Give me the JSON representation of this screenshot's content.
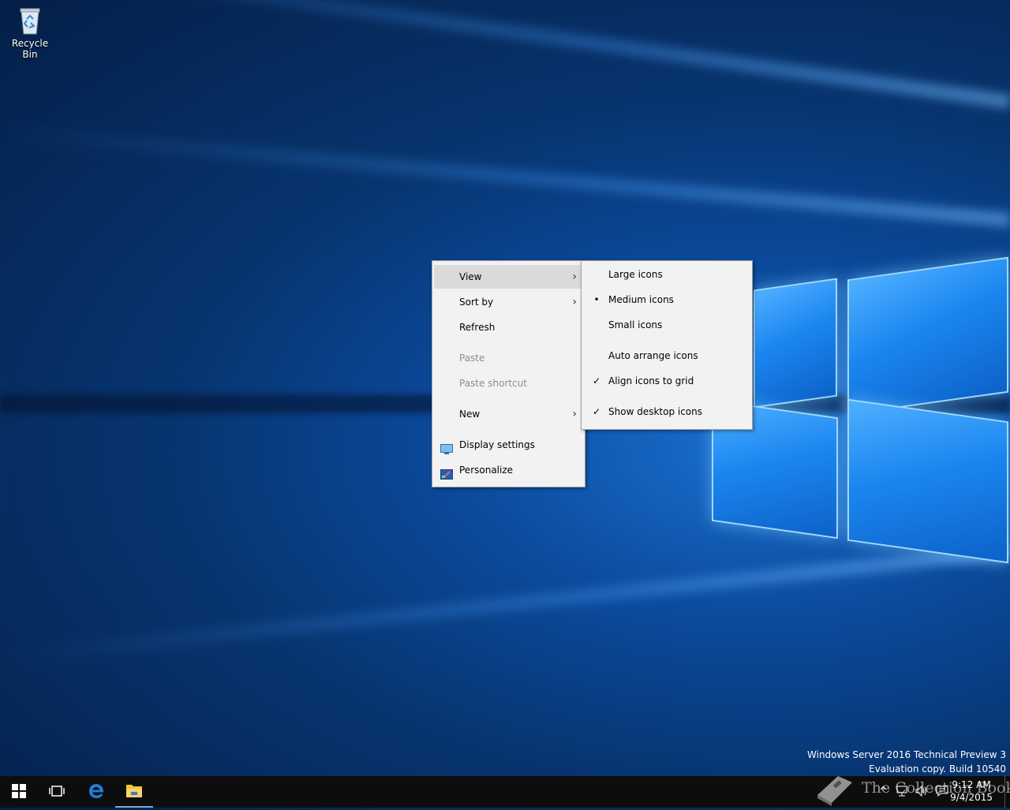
{
  "desktop": {
    "recycle_bin_label": "Recycle Bin"
  },
  "context_menu": {
    "items": [
      {
        "label": "View",
        "state": "highlighted",
        "has_submenu": true
      },
      {
        "label": "Sort by",
        "has_submenu": true
      },
      {
        "label": "Refresh"
      },
      {
        "label": "Paste",
        "state": "disabled"
      },
      {
        "label": "Paste shortcut",
        "state": "disabled"
      },
      {
        "label": "New",
        "has_submenu": true
      },
      {
        "label": "Display settings",
        "icon": "display-settings-icon"
      },
      {
        "label": "Personalize",
        "icon": "personalize-icon"
      }
    ]
  },
  "view_submenu": {
    "items": [
      {
        "label": "Large icons",
        "mark": ""
      },
      {
        "label": "Medium icons",
        "mark": "•"
      },
      {
        "label": "Small icons",
        "mark": ""
      },
      {
        "label": "Auto arrange icons",
        "mark": ""
      },
      {
        "label": "Align icons to grid",
        "mark": "✓"
      },
      {
        "label": "Show desktop icons",
        "mark": "✓"
      }
    ]
  },
  "watermark": {
    "line1": "Windows Server 2016 Technical Preview 3",
    "line2": "Evaluation copy. Build 10540"
  },
  "taskbar": {
    "time": "9:12 AM",
    "date": "9/4/2015",
    "pinned_icons": [
      "start-icon",
      "task-view-icon",
      "edge-icon",
      "file-explorer-icon"
    ],
    "tray_icons": [
      "show-hidden-icons-chevron",
      "network-icon",
      "volume-icon",
      "action-center-icon"
    ]
  },
  "brand_overlay": {
    "text": "The Collection Book"
  },
  "colors": {
    "menu_bg": "#f2f2f2",
    "menu_highlight": "#dadada",
    "disabled_text": "#8d8d8d",
    "taskbar": "#0d0d0d",
    "edge_blue": "#1e7fd6",
    "explorer_yellow": "#f3c33a"
  }
}
